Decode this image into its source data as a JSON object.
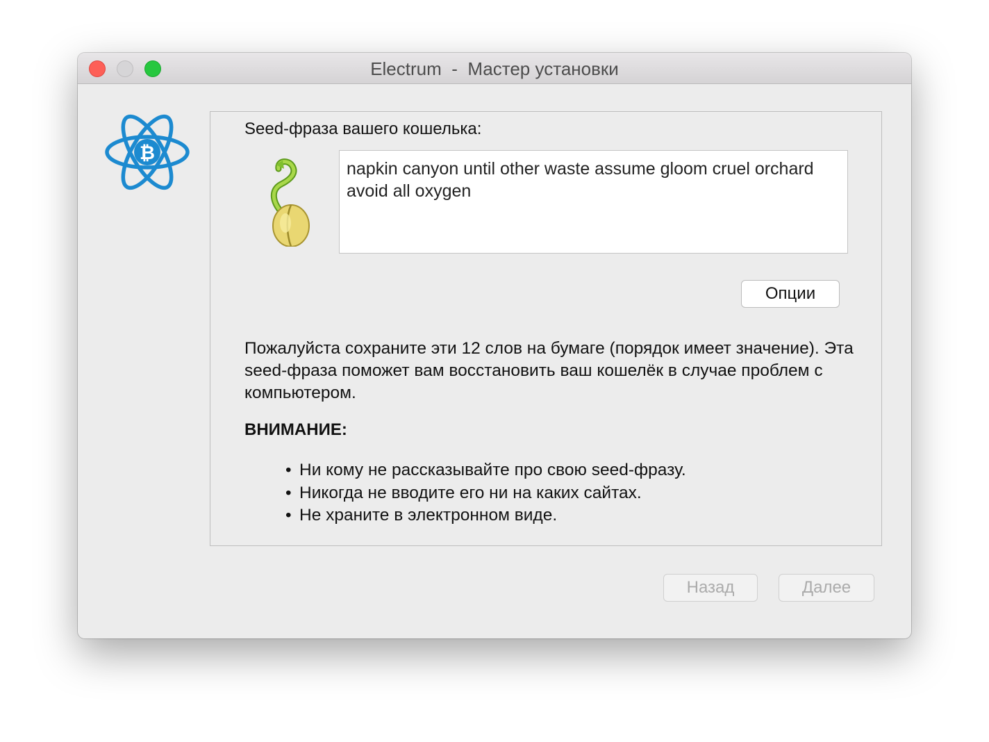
{
  "window": {
    "title": "Electrum  -  Мастер установки"
  },
  "logo": {
    "icon": "electrum-bitcoin-atom-logo",
    "color": "#1c8ad0"
  },
  "seed": {
    "label": "Seed-фраза вашего кошелька:",
    "icon": "seed-sprout-icon",
    "phrase": "napkin canyon until other waste assume gloom cruel orchard avoid all oxygen"
  },
  "options_button": {
    "label": "Опции"
  },
  "instructions": {
    "text": "Пожалуйста сохраните эти 12 слов на бумаге (порядок имеет значение). Эта seed-фраза поможет вам восстановить ваш кошелёк в случае проблем с компьютером.",
    "warning_title": "ВНИМАНИЕ:",
    "bullets": [
      "Ни кому не рассказывайте про свою seed-фразу.",
      "Никогда не вводите его ни на каких сайтах.",
      "Не храните в электронном виде."
    ]
  },
  "footer": {
    "back_label": "Назад",
    "next_label": "Далее",
    "back_enabled": false,
    "next_enabled": false
  }
}
